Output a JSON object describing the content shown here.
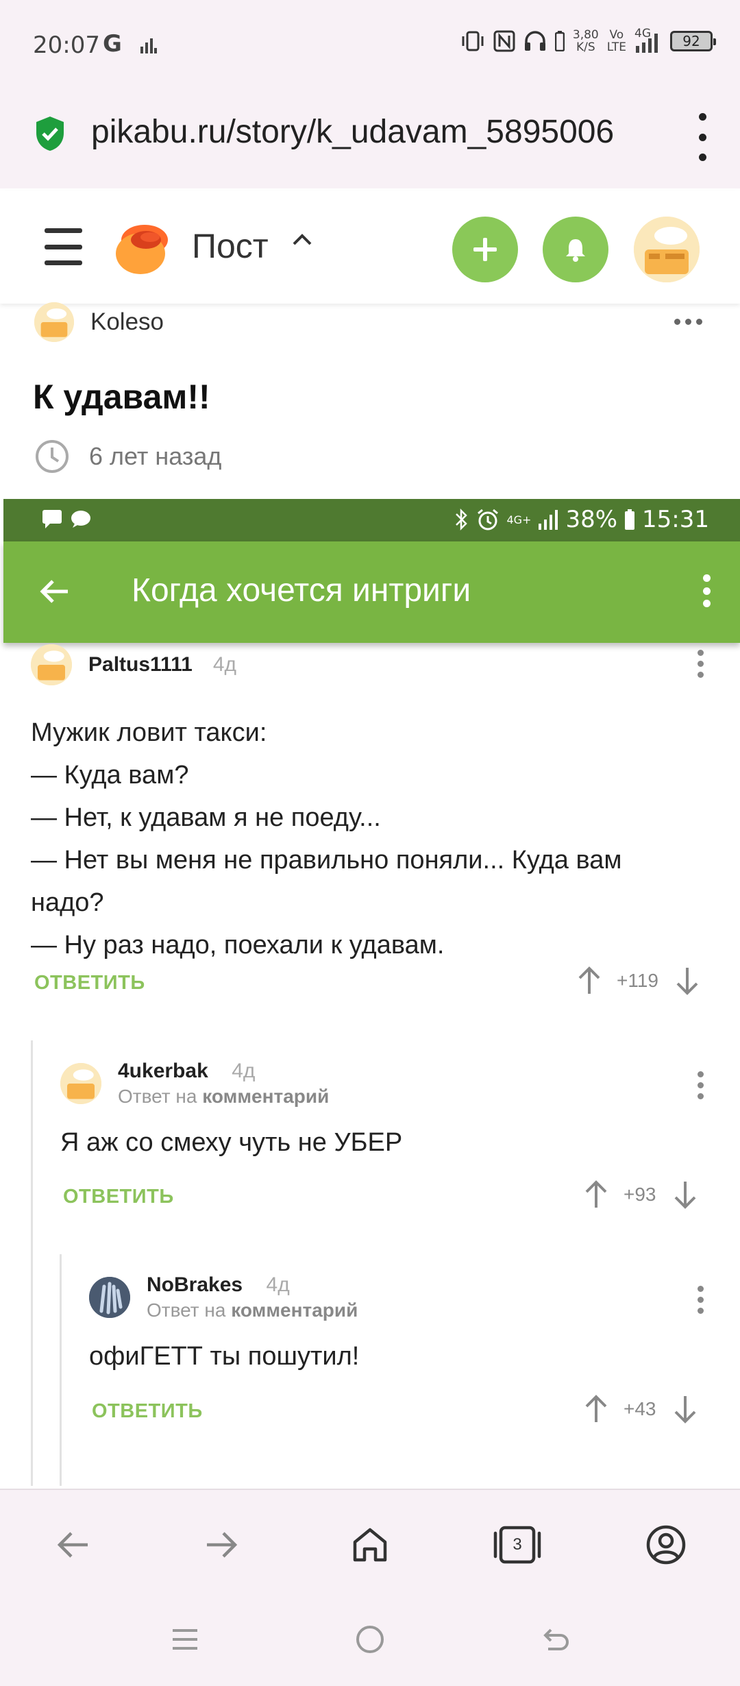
{
  "status_bar": {
    "time": "20:07",
    "google_icon": "G",
    "speed_value": "3,80",
    "speed_unit": "K/S",
    "volte_top": "Vo",
    "volte_bottom": "LTE",
    "network": "4G",
    "battery": "92"
  },
  "browser": {
    "url": "pikabu.ru/story/k_udavam_5895006"
  },
  "header": {
    "title": "Пост",
    "colors": {
      "green": "#8ac858"
    }
  },
  "post": {
    "author": "Koleso",
    "title": "К удавам!!",
    "time_ago": "6 лет назад"
  },
  "embedded": {
    "status": {
      "network": "4G+",
      "battery": "38%",
      "time": "15:31"
    },
    "appbar_title": "Когда хочется интриги",
    "colors": {
      "appbar": "#79b543",
      "status": "#4f7a30"
    },
    "comments": [
      {
        "author": "Paltus1111",
        "ago": "4д",
        "lines": [
          "Мужик ловит такси:",
          "— Куда вам?",
          "— Нет, к удавам я не поеду...",
          "— Нет вы меня не правильно поняли... Куда вам",
          "надо?",
          "— Ну раз надо, поехали к удавам."
        ],
        "reply": "ОТВЕТИТЬ",
        "score": "+119"
      },
      {
        "author": "4ukerbak",
        "ago": "4д",
        "reply_to_prefix": "Ответ на",
        "reply_to_target": "комментарий",
        "text": "Я аж со смеху чуть не УБЕР",
        "reply": "ОТВЕТИТЬ",
        "score": "+93"
      },
      {
        "author": "NoBrakes",
        "ago": "4д",
        "reply_to_prefix": "Ответ на",
        "reply_to_target": "комментарий",
        "text": "офиГЕТТ ты пошутил!",
        "reply": "ОТВЕТИТЬ",
        "score": "+43"
      }
    ]
  },
  "bottom_nav": {
    "tab_count": "3"
  }
}
